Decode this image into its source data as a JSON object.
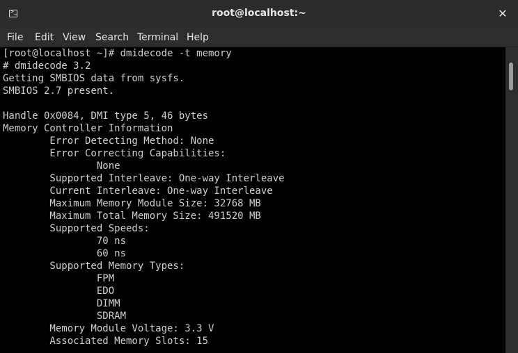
{
  "window": {
    "title": "root@localhost:~",
    "terminal_icon": "terminal-icon",
    "close_glyph": "✕"
  },
  "menu": {
    "items": [
      "File",
      "Edit",
      "View",
      "Search",
      "Terminal",
      "Help"
    ]
  },
  "terminal": {
    "lines": [
      "[root@localhost ~]# dmidecode -t memory",
      "# dmidecode 3.2",
      "Getting SMBIOS data from sysfs.",
      "SMBIOS 2.7 present.",
      "",
      "Handle 0x0084, DMI type 5, 46 bytes",
      "Memory Controller Information",
      "        Error Detecting Method: None",
      "        Error Correcting Capabilities:",
      "                None",
      "        Supported Interleave: One-way Interleave",
      "        Current Interleave: One-way Interleave",
      "        Maximum Memory Module Size: 32768 MB",
      "        Maximum Total Memory Size: 491520 MB",
      "        Supported Speeds:",
      "                70 ns",
      "                60 ns",
      "        Supported Memory Types:",
      "                FPM",
      "                EDO",
      "                DIMM",
      "                SDRAM",
      "        Memory Module Voltage: 3.3 V",
      "        Associated Memory Slots: 15"
    ]
  },
  "colors": {
    "terminal_bg": "#000000",
    "terminal_fg": "#d0d0d0",
    "chrome_bg": "#2d2d2d"
  }
}
